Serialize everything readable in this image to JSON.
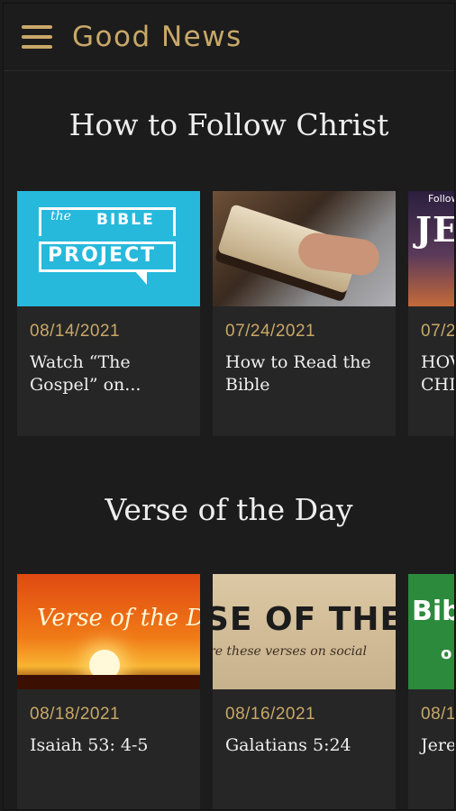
{
  "appbar": {
    "title": "Good News",
    "menu_icon": "hamburger-menu-icon"
  },
  "colors": {
    "accent": "#c9a868",
    "background": "#1c1c1c",
    "card": "#262626",
    "text": "#efefef"
  },
  "sections": [
    {
      "title": "How to Follow Christ",
      "cards": [
        {
          "date": "08/14/2021",
          "title": "Watch “The\nGospel” on...",
          "thumb": {
            "line1": "the",
            "line2": "BIBLE",
            "line3": "PROJECT"
          }
        },
        {
          "date": "07/24/2021",
          "title": "How to Read the\nBible"
        },
        {
          "date": "07/2",
          "title": "HOV\nCHI",
          "thumb": {
            "top": "Follow",
            "big": "JES"
          }
        }
      ]
    },
    {
      "title": "Verse of the Day",
      "cards": [
        {
          "date": "08/18/2021",
          "title": "Isaiah 53: 4-5",
          "thumb": {
            "text": "Verse of the Day"
          }
        },
        {
          "date": "08/16/2021",
          "title": "Galatians 5:24",
          "thumb": {
            "big": "SE OF THE",
            "sub": "re these verses on social"
          }
        },
        {
          "date": "08/1",
          "title": "Jere",
          "thumb": {
            "big": "Bib",
            "small": "o"
          }
        }
      ]
    }
  ]
}
